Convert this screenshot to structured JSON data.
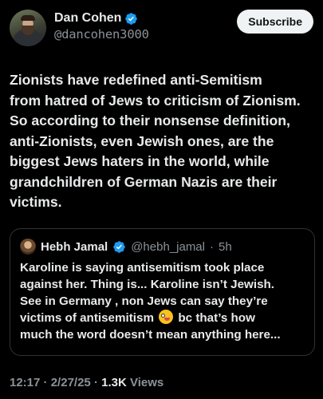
{
  "author": {
    "display_name": "Dan Cohen",
    "handle": "@dancohen3000",
    "verified": true
  },
  "subscribe_label": "Subscribe",
  "tweet_text": "Zionists have redefined anti-Semitism\nfrom hatred of Jews to criticism of Zionism.\nSo according to their nonsense definition,\nanti-Zionists, even Jewish ones, are the\nbiggest Jews haters in the world, while\ngrandchildren of German Nazis are their\nvictims.",
  "quote": {
    "display_name": "Hebh Jamal",
    "handle": "@hebh_jamal",
    "separator": "·",
    "time": "5h",
    "text_before_emoji": "Karoline is saying antisemitism took place\nagainst her. Thing is... Karoline isn’t Jewish.\nSee in Germany , non Jews can say they’re\nvictims of antisemitism ",
    "emoji": "zany-face-emoji",
    "text_after_emoji": " bc that’s how\nmuch the word doesn’t mean anything here..."
  },
  "meta": {
    "time": "12:17",
    "sep1": "·",
    "date": "2/27/25",
    "sep2": "·",
    "views_count": "1.3K",
    "views_label": "Views"
  },
  "colors": {
    "background": "#000000",
    "text": "#e7e9ea",
    "secondary": "#8b9298",
    "verified": "#1d9bf0",
    "border": "#2f3336"
  }
}
